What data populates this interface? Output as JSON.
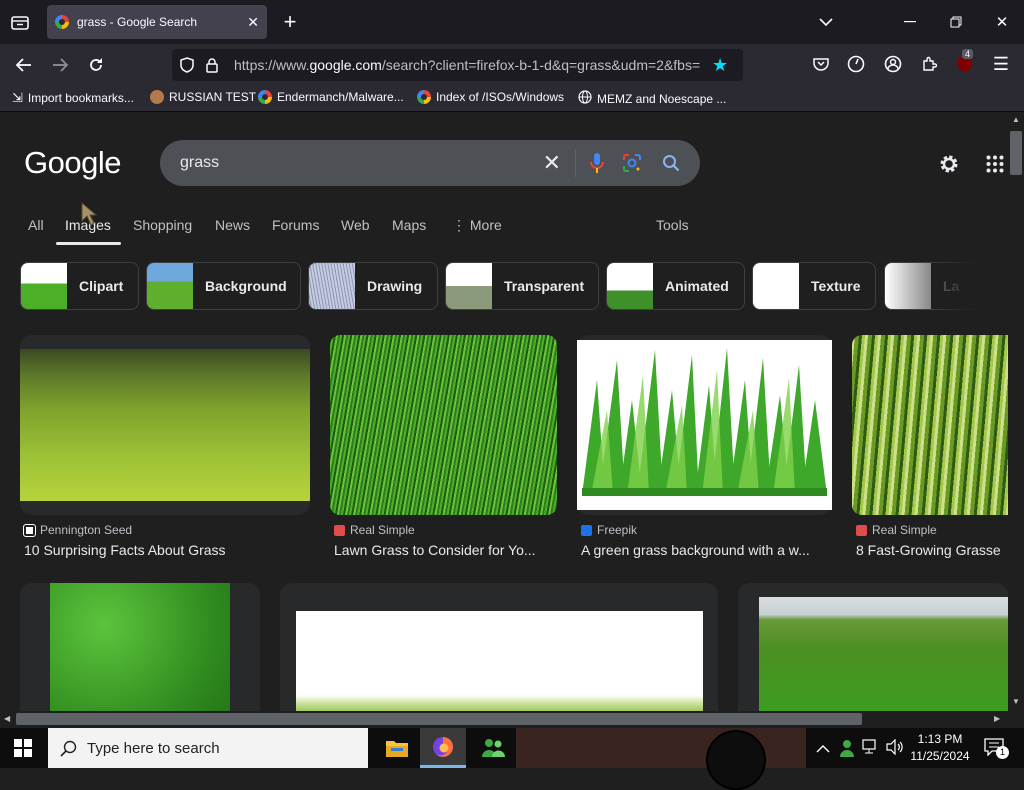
{
  "browser": {
    "tab_title": "grass - Google Search",
    "new_tab_symbol": "+",
    "url_prefix": "https://www.",
    "url_domain": "google.com",
    "url_rest": "/search?client=firefox-b-1-d&q=grass&udm=2&fbs=",
    "extension_badge": "4",
    "bookmarks": [
      {
        "label": "Import bookmarks...",
        "icon": "import-icon"
      },
      {
        "label": "RUSSIAN TEST",
        "icon": "avatar-icon"
      },
      {
        "label": "Endermanch/Malware...",
        "icon": "google-icon"
      },
      {
        "label": "Index of /ISOs/Windows",
        "icon": "google-icon"
      },
      {
        "label": "MEMZ and Noescape ...",
        "icon": "globe-icon"
      }
    ]
  },
  "google": {
    "logo": "Google",
    "query": "grass",
    "nav_tabs": [
      "All",
      "Images",
      "Shopping",
      "News",
      "Forums",
      "Web",
      "Maps",
      "More",
      "Tools"
    ],
    "active_tab": "Images",
    "chips": [
      "Clipart",
      "Background",
      "Drawing",
      "Transparent",
      "Animated",
      "Texture",
      "La"
    ],
    "results": [
      {
        "source": "Pennington Seed",
        "title": "10 Surprising Facts About Grass",
        "badge_color": "#ffffff"
      },
      {
        "source": "Real Simple",
        "title": "Lawn Grass to Consider for Yo...",
        "badge_color": "#e04b4b"
      },
      {
        "source": "Freepik",
        "title": "A green grass background with a w...",
        "badge_color": "#1a73e8"
      },
      {
        "source": "Real Simple",
        "title": "8 Fast-Growing Grasse",
        "badge_color": "#e04b4b"
      }
    ]
  },
  "taskbar": {
    "search_placeholder": "Type here to search",
    "time": "1:13 PM",
    "date": "11/25/2024",
    "notification_count": "1"
  },
  "colors": {
    "accent_blue": "#8ab4f8",
    "star_blue": "#00ddff",
    "page_bg": "#1f1f1f"
  }
}
